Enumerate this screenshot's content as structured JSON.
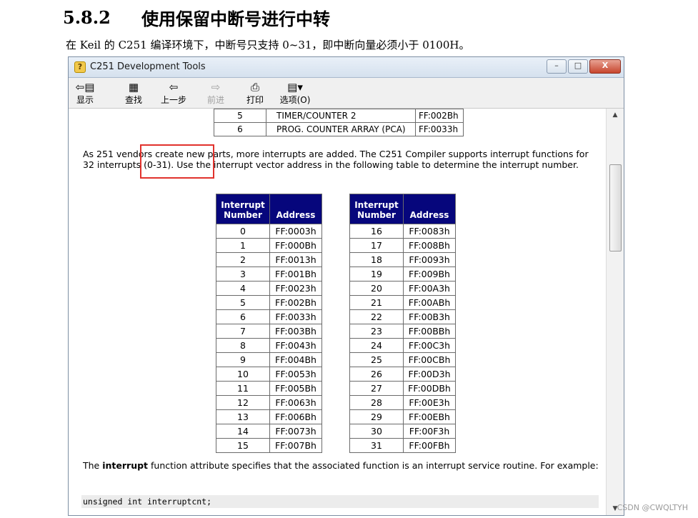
{
  "doc": {
    "section_number": "5.8.2",
    "section_title": "使用保留中断号进行中转",
    "paragraph": "在 Keil 的 C251 编译环境下，中断号只支持 0~31，即中断向量必须小于 0100H。"
  },
  "window": {
    "title": "C251 Development Tools",
    "buttons": {
      "minimize": "–",
      "maximize": "□",
      "close": "X"
    }
  },
  "toolbar": [
    {
      "label": "显示",
      "icon": "show-icon",
      "glyph": "⇦▤",
      "enabled": true
    },
    {
      "label": "查找",
      "icon": "find-icon",
      "glyph": "▦",
      "enabled": true
    },
    {
      "label": "上一步",
      "icon": "back-icon",
      "glyph": "⇦",
      "enabled": true
    },
    {
      "label": "前进",
      "icon": "forward-icon",
      "glyph": "⇨",
      "enabled": false
    },
    {
      "label": "打印",
      "icon": "print-icon",
      "glyph": "⎙",
      "enabled": true
    },
    {
      "label": "选项(O)",
      "icon": "options-icon",
      "glyph": "▤▾",
      "enabled": true
    }
  ],
  "partial_table": [
    {
      "num": "5",
      "desc": "TIMER/COUNTER 2",
      "addr": "FF:002Bh"
    },
    {
      "num": "6",
      "desc": "PROG. COUNTER ARRAY (PCA)",
      "addr": "FF:0033h"
    }
  ],
  "intro_text": "As 251 vendors create new parts, more interrupts are added. The C251 Compiler supports interrupt functions for 32 interrupts (0-31). Use the interrupt vector address in the following table to determine the interrupt number.",
  "interrupt_table": {
    "header_num": "Interrupt Number",
    "header_addr": "Address",
    "left": [
      [
        "0",
        "FF:0003h"
      ],
      [
        "1",
        "FF:000Bh"
      ],
      [
        "2",
        "FF:0013h"
      ],
      [
        "3",
        "FF:001Bh"
      ],
      [
        "4",
        "FF:0023h"
      ],
      [
        "5",
        "FF:002Bh"
      ],
      [
        "6",
        "FF:0033h"
      ],
      [
        "7",
        "FF:003Bh"
      ],
      [
        "8",
        "FF:0043h"
      ],
      [
        "9",
        "FF:004Bh"
      ],
      [
        "10",
        "FF:0053h"
      ],
      [
        "11",
        "FF:005Bh"
      ],
      [
        "12",
        "FF:0063h"
      ],
      [
        "13",
        "FF:006Bh"
      ],
      [
        "14",
        "FF:0073h"
      ],
      [
        "15",
        "FF:007Bh"
      ]
    ],
    "right": [
      [
        "16",
        "FF:0083h"
      ],
      [
        "17",
        "FF:008Bh"
      ],
      [
        "18",
        "FF:0093h"
      ],
      [
        "19",
        "FF:009Bh"
      ],
      [
        "20",
        "FF:00A3h"
      ],
      [
        "21",
        "FF:00ABh"
      ],
      [
        "22",
        "FF:00B3h"
      ],
      [
        "23",
        "FF:00BBh"
      ],
      [
        "24",
        "FF:00C3h"
      ],
      [
        "25",
        "FF:00CBh"
      ],
      [
        "26",
        "FF:00D3h"
      ],
      [
        "27",
        "FF:00DBh"
      ],
      [
        "28",
        "FF:00E3h"
      ],
      [
        "29",
        "FF:00EBh"
      ],
      [
        "30",
        "FF:00F3h"
      ],
      [
        "31",
        "FF:00FBh"
      ]
    ]
  },
  "outro": {
    "before": "The ",
    "keyword": "interrupt",
    "after": " function attribute specifies that the associated function is an interrupt service routine. For example:"
  },
  "code_line": "unsigned int  interruptcnt;",
  "watermark": "CSDN @CWQLTYH"
}
